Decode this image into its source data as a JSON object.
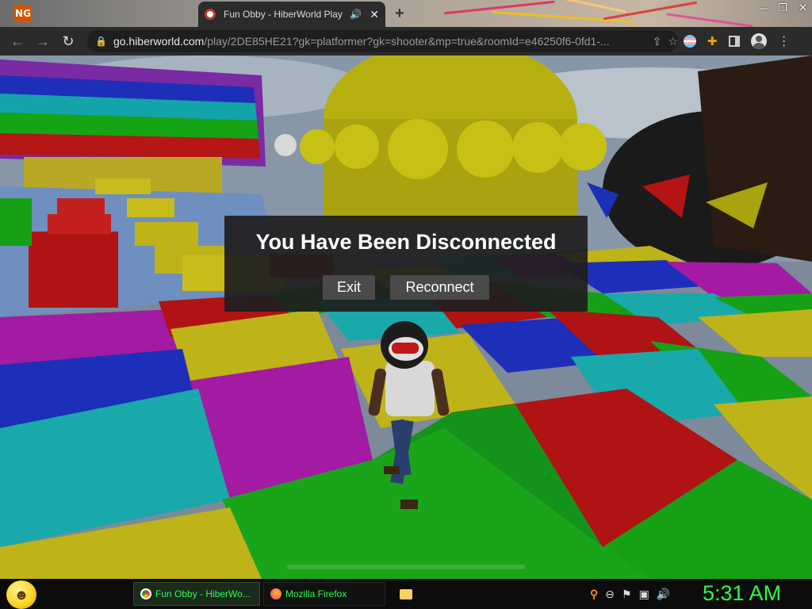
{
  "browser": {
    "inactive_tab_label": "",
    "active_tab_title": "Fun Obby - HiberWorld Play",
    "new_tab_symbol": "+",
    "url_host": "go.hiberworld.com",
    "url_path": "/play/2DE85HE21?gk=platformer?gk=shooter&mp=true&roomId=e46250f6-0fd1-...",
    "icons": [
      "back-arrow-icon",
      "forward-arrow-icon",
      "reload-icon",
      "lock-icon",
      "share-icon",
      "star-icon",
      "puzzle-icon",
      "sidepanel-icon",
      "profile-icon",
      "menu-icon"
    ]
  },
  "app_logo": "NG",
  "dialog": {
    "title": "You Have Been Disconnected",
    "exit_label": "Exit",
    "reconnect_label": "Reconnect"
  },
  "taskbar": {
    "items": [
      {
        "label": "Fun Obby - HiberWo...",
        "icon": "chrome-icon"
      },
      {
        "label": "Mozilla Firefox",
        "icon": "firefox-icon"
      },
      {
        "label": "",
        "icon": "folder-icon"
      }
    ],
    "clock": "5:31 AM",
    "accent": "#26ff4a"
  }
}
